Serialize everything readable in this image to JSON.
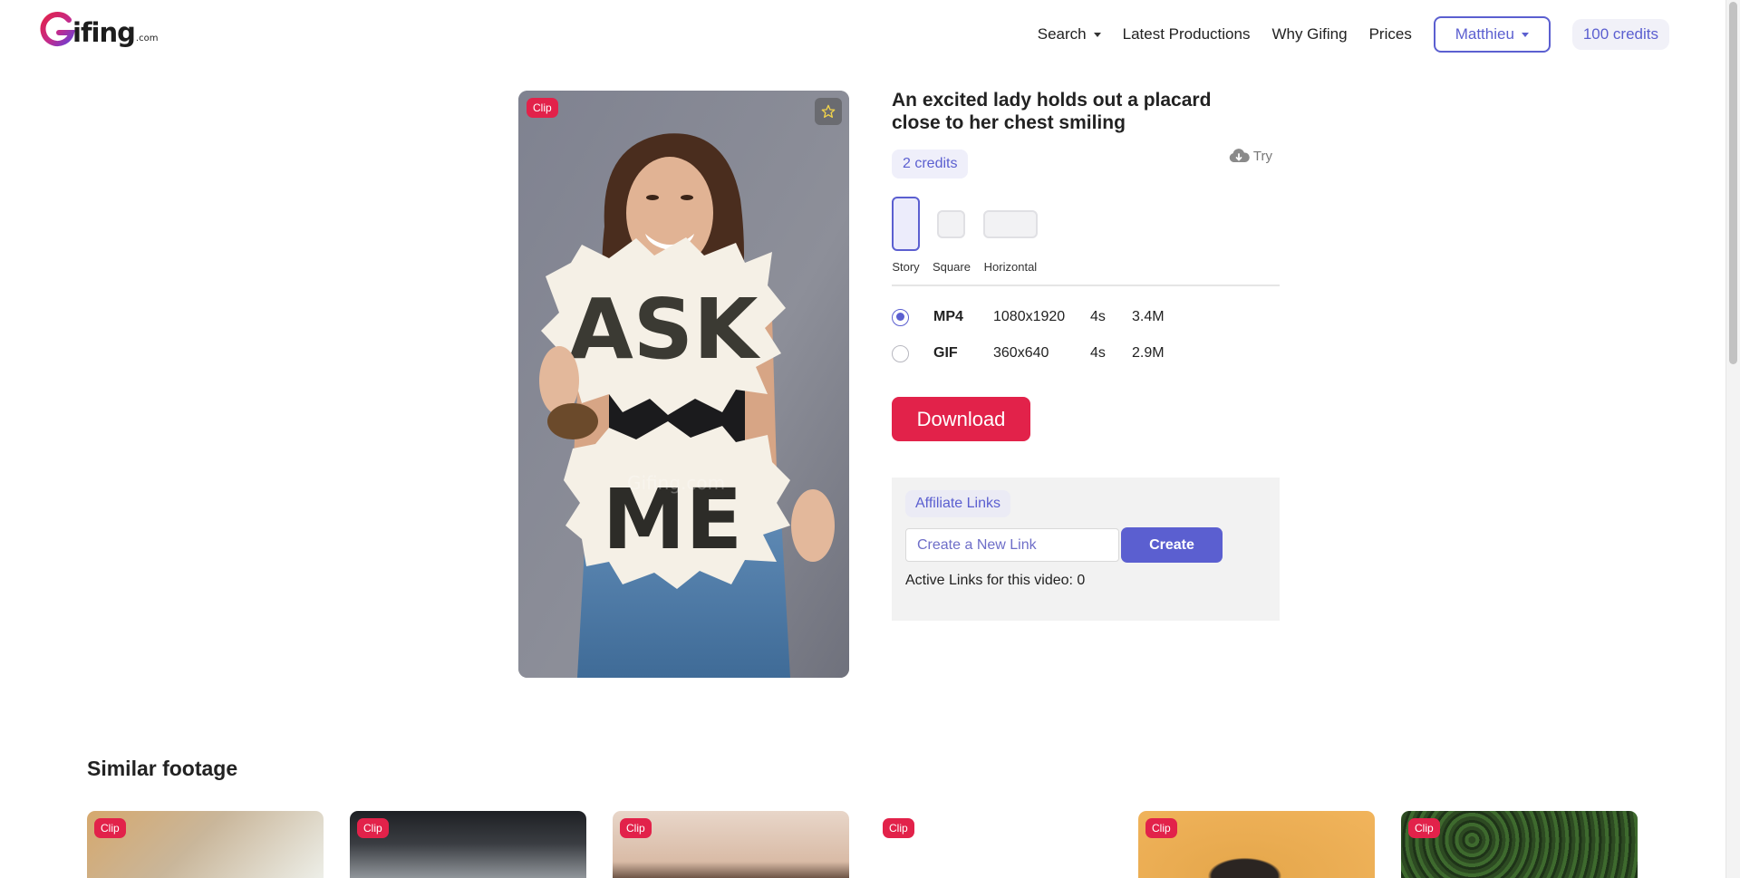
{
  "header": {
    "logo": {
      "word": "ifing",
      "suffix": ".com"
    },
    "nav": {
      "search": "Search",
      "latest": "Latest Productions",
      "why": "Why Gifing",
      "prices": "Prices"
    },
    "user": "Matthieu",
    "credits": "100 credits"
  },
  "video": {
    "badge": "Clip",
    "sign_top": "ASK",
    "sign_bottom": "ME",
    "watermark": "Gifing.com"
  },
  "detail": {
    "title": "An excited lady holds out a placard close to her chest smiling",
    "price": "2 credits",
    "try": "Try",
    "formats": [
      {
        "label": "Story",
        "selected": true
      },
      {
        "label": "Square",
        "selected": false
      },
      {
        "label": "Horizontal",
        "selected": false
      }
    ],
    "files": [
      {
        "type": "MP4",
        "resolution": "1080x1920",
        "duration": "4s",
        "size": "3.4M",
        "selected": true
      },
      {
        "type": "GIF",
        "resolution": "360x640",
        "duration": "4s",
        "size": "2.9M",
        "selected": false
      }
    ],
    "download": "Download"
  },
  "affiliate": {
    "label": "Affiliate Links",
    "placeholder": "Create a New Link",
    "create": "Create",
    "active_prefix": "Active Links for this video: ",
    "active_count": "0"
  },
  "similar": {
    "title": "Similar footage",
    "items": [
      {
        "badge": "Clip"
      },
      {
        "badge": "Clip"
      },
      {
        "badge": "Clip"
      },
      {
        "badge": "Clip"
      },
      {
        "badge": "Clip"
      },
      {
        "badge": "Clip"
      }
    ]
  },
  "colors": {
    "accent": "#5b5fd0",
    "brand_red": "#e2224a",
    "panel_bg": "#f2f2f2"
  },
  "icons": [
    "logo-g-icon",
    "chevron-down-icon",
    "star-icon",
    "cloud-download-icon"
  ]
}
